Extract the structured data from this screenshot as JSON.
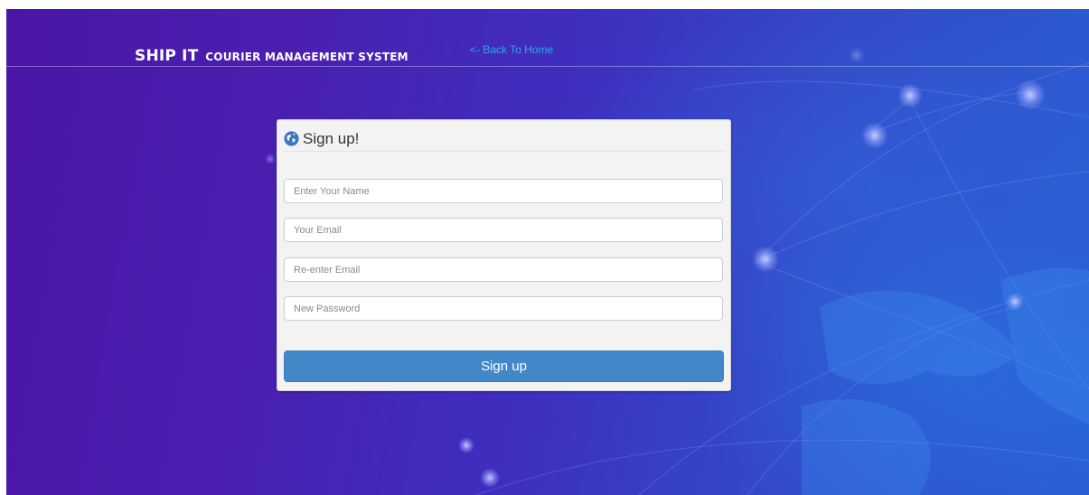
{
  "header": {
    "brand_main": "SHIP IT",
    "brand_sub": "COURIER MANAGEMENT SYSTEM",
    "back_link": "<- Back To Home"
  },
  "form": {
    "title": "Sign up!",
    "title_icon": "globe-icon",
    "fields": [
      {
        "placeholder": "Enter Your Name",
        "value": ""
      },
      {
        "placeholder": "Your Email",
        "value": ""
      },
      {
        "placeholder": "Re-enter Email",
        "value": ""
      },
      {
        "placeholder": "New Password",
        "value": ""
      }
    ],
    "submit_label": "Sign up"
  },
  "colors": {
    "background_start": "#4a16a6",
    "background_end": "#2a5ed4",
    "link": "#2fa8e6",
    "button": "#4288c9",
    "panel": "#f3f3f3"
  }
}
